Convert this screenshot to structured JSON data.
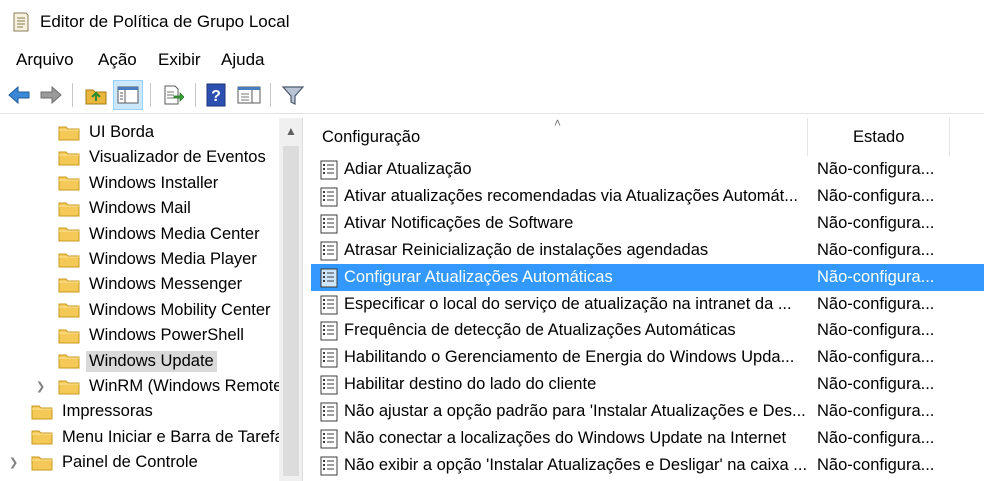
{
  "window": {
    "title": "Editor de Política de Grupo Local"
  },
  "menu": [
    "Arquivo",
    "Ação",
    "Exibir",
    "Ajuda"
  ],
  "toolbar": {
    "buttons": [
      "back-arrow-icon",
      "forward-arrow-icon",
      "up-folder-icon",
      "show-hide-tree-icon",
      "export-list-icon",
      "help-icon",
      "properties-view-icon",
      "filter-icon"
    ]
  },
  "tree": {
    "items": [
      {
        "label": "UI Borda"
      },
      {
        "label": "Visualizador de Eventos"
      },
      {
        "label": "Windows Installer"
      },
      {
        "label": "Windows Mail"
      },
      {
        "label": "Windows Media Center"
      },
      {
        "label": "Windows Media Player"
      },
      {
        "label": "Windows Messenger"
      },
      {
        "label": "Windows Mobility Center"
      },
      {
        "label": "Windows PowerShell"
      },
      {
        "label": "Windows Update",
        "selected": true
      },
      {
        "label": "WinRM (Windows Remote",
        "expandable": true
      },
      {
        "label": "Impressoras"
      },
      {
        "label": "Menu Iniciar e Barra de Tarefa"
      },
      {
        "label": "Painel de Controle",
        "expandable": true
      }
    ]
  },
  "list": {
    "columns": {
      "setting": "Configuração",
      "state": "Estado"
    },
    "rows": [
      {
        "name": "Adiar Atualização",
        "state": "Não-configura..."
      },
      {
        "name": "Ativar atualizações recomendadas via Atualizações Automát...",
        "state": "Não-configura..."
      },
      {
        "name": "Ativar Notificações de Software",
        "state": "Não-configura..."
      },
      {
        "name": "Atrasar Reinicialização de instalações agendadas",
        "state": "Não-configura..."
      },
      {
        "name": "Configurar Atualizações Automáticas",
        "state": "Não-configura...",
        "selected": true
      },
      {
        "name": "Especificar o local do serviço de atualização na intranet da ...",
        "state": "Não-configura..."
      },
      {
        "name": "Frequência de detecção de Atualizações Automáticas",
        "state": "Não-configura..."
      },
      {
        "name": "Habilitando o Gerenciamento de Energia do Windows Upda...",
        "state": "Não-configura..."
      },
      {
        "name": "Habilitar destino do lado do cliente",
        "state": "Não-configura..."
      },
      {
        "name": "Não ajustar a opção padrão para 'Instalar Atualizações e Des...",
        "state": "Não-configura..."
      },
      {
        "name": "Não conectar a localizações do Windows Update na Internet",
        "state": "Não-configura..."
      },
      {
        "name": "Não exibir a opção 'Instalar Atualizações e Desligar' na caixa ...",
        "state": "Não-configura..."
      }
    ]
  },
  "colors": {
    "selection": "#3399ff",
    "tree_selection": "#d9d9d9",
    "folder": "#f4c957"
  }
}
